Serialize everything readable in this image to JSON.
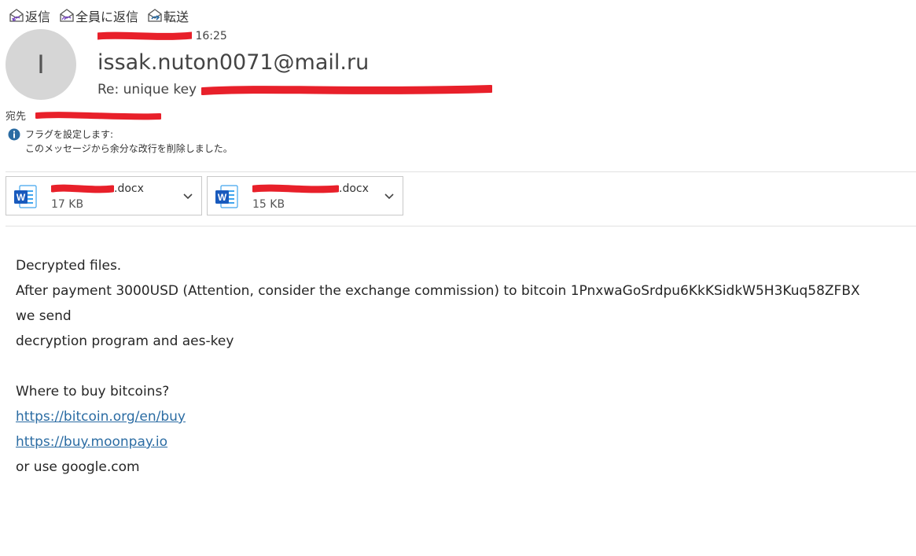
{
  "toolbar": {
    "reply_label": "返信",
    "reply_all_label": "全員に返信",
    "forward_label": "転送"
  },
  "header": {
    "avatar_initial": "I",
    "time": "16:25",
    "sender": "issak.nuton0071@mail.ru",
    "subject_prefix": "Re: unique key",
    "to_label": "宛先"
  },
  "flag": {
    "line1": "フラグを設定します:",
    "line2": "このメッセージから余分な改行を削除しました。"
  },
  "attachments": [
    {
      "name_suffix": ".docx",
      "size": "17 KB",
      "icon": "word-icon"
    },
    {
      "name_suffix": ".docx",
      "size": "15 KB",
      "icon": "word-icon"
    }
  ],
  "body": {
    "lines": [
      "Decrypted files.",
      "After payment 3000USD (Attention, consider the exchange commission) to bitcoin 1PnxwaGoSrdpu6KkKSidkW5H3Kuq58ZFBX",
      "we send",
      "decryption program and aes-key",
      "",
      "Where to buy bitcoins?",
      "https://bitcoin.org/en/buy",
      "https://buy.moonpay.io",
      "or use google.com"
    ]
  },
  "colors": {
    "redaction": "#e8202a",
    "link": "#2b6ca3",
    "word_blue": "#185abd"
  }
}
